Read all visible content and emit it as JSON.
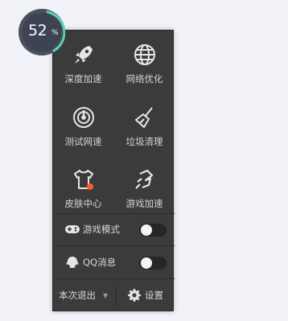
{
  "badge": {
    "value": "52",
    "unit": "%",
    "ring_color": "#5fd0b8"
  },
  "tiles": [
    {
      "label": "深度加速",
      "icon": "rocket-icon"
    },
    {
      "label": "网络优化",
      "icon": "globe-icon"
    },
    {
      "label": "测试网速",
      "icon": "speedometer-icon"
    },
    {
      "label": "垃圾清理",
      "icon": "broom-icon"
    },
    {
      "label": "皮肤中心",
      "icon": "shirt-icon"
    },
    {
      "label": "游戏加速",
      "icon": "game-boost-icon"
    }
  ],
  "rows": [
    {
      "label": "游戏模式",
      "icon": "gamepad-icon",
      "toggle": "off"
    },
    {
      "label": "QQ消息",
      "icon": "qq-icon",
      "toggle": "off"
    }
  ],
  "bottom": {
    "exit_label": "本次退出",
    "caret": "▼",
    "settings_label": "设置"
  },
  "colors": {
    "panel": "#3b3b3b",
    "accent_dot": "#ff5a2a"
  }
}
